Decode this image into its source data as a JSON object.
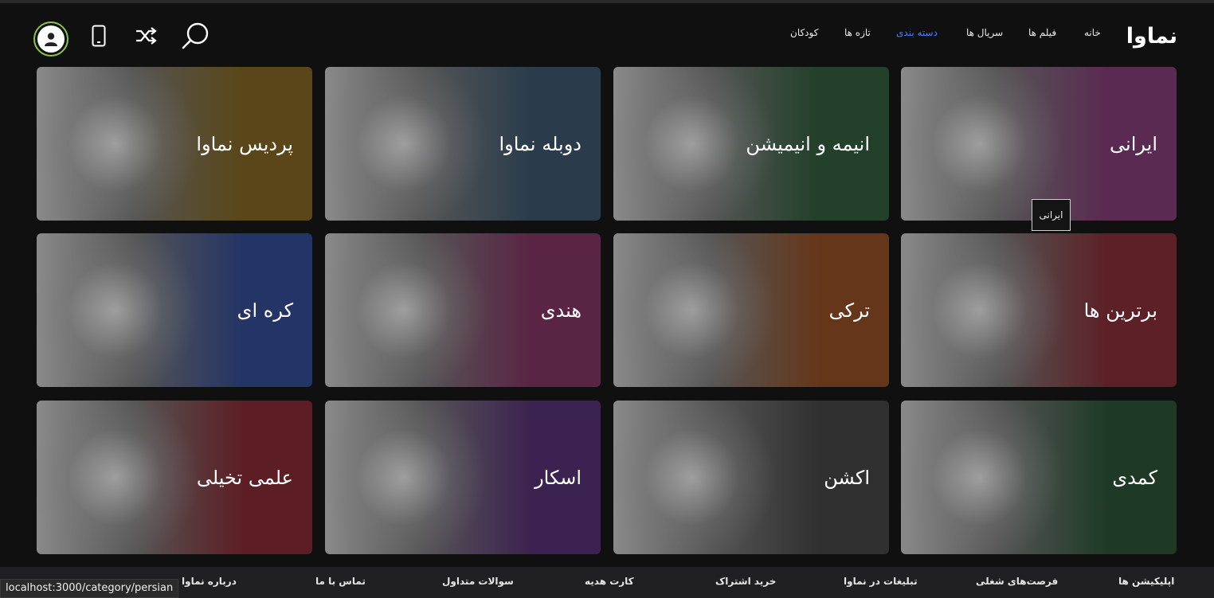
{
  "header": {
    "logo": "نماوا",
    "nav": [
      {
        "label": "خانه",
        "active": false
      },
      {
        "label": "فیلم ها",
        "active": false
      },
      {
        "label": "سریال ها",
        "active": false
      },
      {
        "label": "دسته بندی",
        "active": true
      },
      {
        "label": "تازه ها",
        "active": false
      },
      {
        "label": "کودکان",
        "active": false
      }
    ],
    "icons": [
      "search-icon",
      "shuffle-icon",
      "mobile-icon",
      "user-avatar-icon"
    ]
  },
  "categories": [
    {
      "label": "ایرانی",
      "color": "#5a2a52"
    },
    {
      "label": "انیمه و انیمیشن",
      "color": "#22402a"
    },
    {
      "label": "دوبله نماوا",
      "color": "#2a3c4c"
    },
    {
      "label": "پردیس نماوا",
      "color": "#5a4618"
    },
    {
      "label": "برترین ها",
      "color": "#5c2026"
    },
    {
      "label": "ترکی",
      "color": "#66361a"
    },
    {
      "label": "هندی",
      "color": "#5a2444"
    },
    {
      "label": "کره ای",
      "color": "#243466"
    },
    {
      "label": "کمدی",
      "color": "#1e3a26"
    },
    {
      "label": "اکشن",
      "color": "#303030"
    },
    {
      "label": "اسکار",
      "color": "#3c2250"
    },
    {
      "label": "علمی تخیلی",
      "color": "#5c1e24"
    }
  ],
  "tooltip": "ایرانی",
  "footer": {
    "links": [
      "اپلیکیشن ها",
      "فرصت‌های شغلی",
      "تبلیغات در نماوا",
      "خرید اشتراک",
      "کارت هدیه",
      "سوالات متداول",
      "تماس با ما",
      "درباره نماوا"
    ]
  },
  "status_url": "localhost:3000/category/persian"
}
